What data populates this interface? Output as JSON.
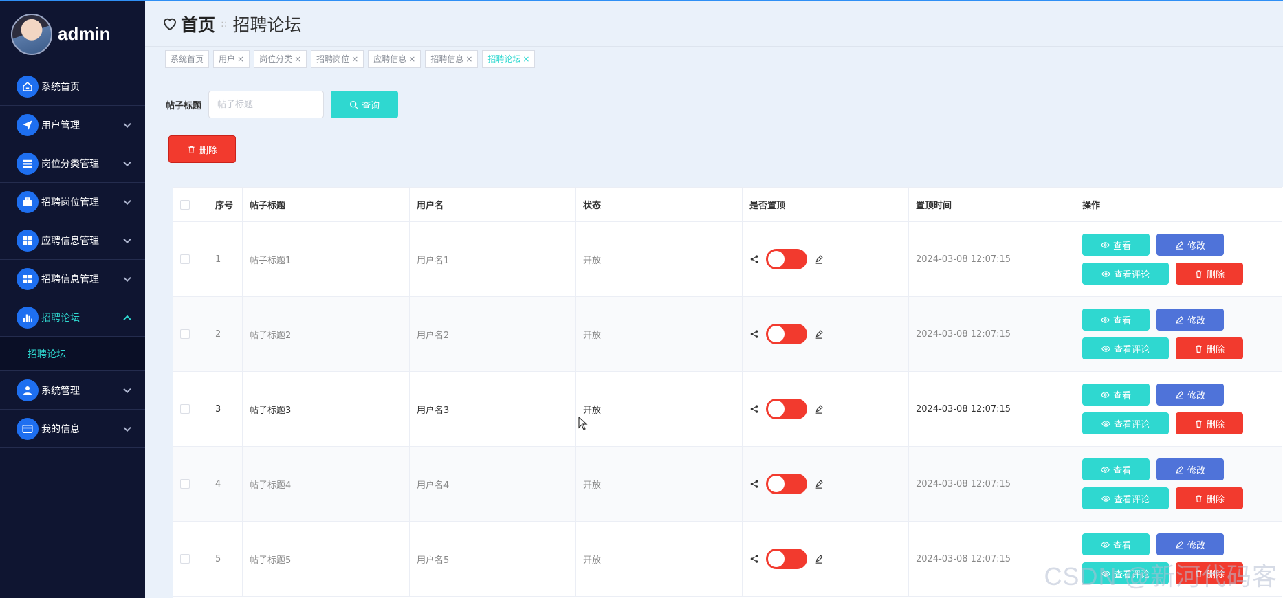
{
  "app": {
    "user": "admin"
  },
  "sidebar": {
    "items": [
      {
        "label": "系统首页",
        "icon": "home-icon"
      },
      {
        "label": "用户管理",
        "icon": "paper-plane-icon"
      },
      {
        "label": "岗位分类管理",
        "icon": "list-icon"
      },
      {
        "label": "招聘岗位管理",
        "icon": "briefcase-icon"
      },
      {
        "label": "应聘信息管理",
        "icon": "grid-icon"
      },
      {
        "label": "招聘信息管理",
        "icon": "grid-icon"
      },
      {
        "label": "招聘论坛",
        "icon": "bar-chart-icon"
      },
      {
        "label": "系统管理",
        "icon": "user-icon"
      },
      {
        "label": "我的信息",
        "icon": "card-icon"
      }
    ],
    "submenu": {
      "label": "招聘论坛"
    }
  },
  "header": {
    "home": "首页",
    "separator": "::",
    "page": "招聘论坛"
  },
  "tags": [
    {
      "label": "系统首页",
      "close": ""
    },
    {
      "label": "用户",
      "close": "×"
    },
    {
      "label": "岗位分类",
      "close": "×"
    },
    {
      "label": "招聘岗位",
      "close": "×"
    },
    {
      "label": "应聘信息",
      "close": "×"
    },
    {
      "label": "招聘信息",
      "close": "×"
    },
    {
      "label": "招聘论坛",
      "close": "×"
    }
  ],
  "search": {
    "label": "帖子标题",
    "placeholder": "帖子标题",
    "value": "",
    "query_button": "查询"
  },
  "toolbar": {
    "delete_button": "删除"
  },
  "table": {
    "headers": [
      "",
      "序号",
      "帖子标题",
      "用户名",
      "状态",
      "是否置顶",
      "置顶时间",
      "操作"
    ],
    "rows": [
      {
        "index": "1",
        "title": "帖子标题1",
        "user": "用户名1",
        "status": "开放",
        "pin_time": "2024-03-08 12:07:15"
      },
      {
        "index": "2",
        "title": "帖子标题2",
        "user": "用户名2",
        "status": "开放",
        "pin_time": "2024-03-08 12:07:15"
      },
      {
        "index": "3",
        "title": "帖子标题3",
        "user": "用户名3",
        "status": "开放",
        "pin_time": "2024-03-08 12:07:15"
      },
      {
        "index": "4",
        "title": "帖子标题4",
        "user": "用户名4",
        "status": "开放",
        "pin_time": "2024-03-08 12:07:15"
      },
      {
        "index": "5",
        "title": "帖子标题5",
        "user": "用户名5",
        "status": "开放",
        "pin_time": "2024-03-08 12:07:15"
      }
    ],
    "actions": {
      "view": "查看",
      "edit": "修改",
      "comments": "查看评论",
      "delete": "删除"
    }
  },
  "watermark": "CSDN @新河代码客",
  "colors": {
    "sidebar_bg": "#0f1531",
    "accent": "#2fd8d0",
    "danger": "#f23a2e",
    "edit": "#4f73d9",
    "menu_icon": "#1e6ff0"
  }
}
